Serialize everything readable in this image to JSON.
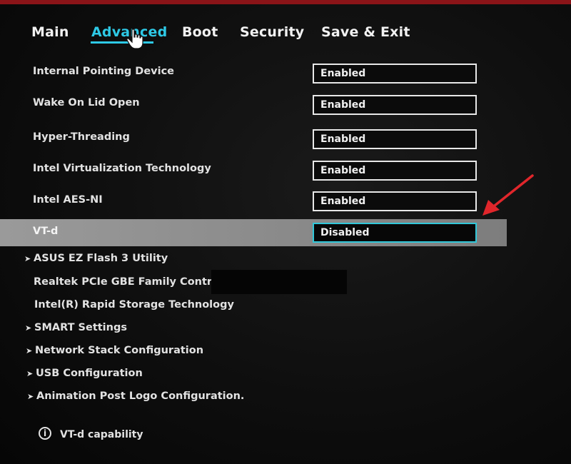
{
  "tabs": [
    "Main",
    "Advanced",
    "Boot",
    "Security",
    "Save & Exit"
  ],
  "settings": [
    {
      "label": "Internal Pointing Device",
      "value": "Enabled"
    },
    {
      "label": "Wake On Lid Open",
      "value": "Enabled"
    },
    {
      "label": "Hyper-Threading",
      "value": "Enabled"
    },
    {
      "label": "Intel Virtualization Technology",
      "value": "Enabled"
    },
    {
      "label": "Intel AES-NI",
      "value": "Enabled"
    },
    {
      "label": "VT-d",
      "value": "Disabled"
    }
  ],
  "menu": [
    {
      "label": "ASUS EZ Flash 3 Utility",
      "submenu": true
    },
    {
      "label": "Realtek PCIe GBE Family Controller",
      "submenu": false
    },
    {
      "label": "Intel(R) Rapid Storage Technology",
      "submenu": false
    },
    {
      "label": "SMART Settings",
      "submenu": true
    },
    {
      "label": "Network Stack Configuration",
      "submenu": true
    },
    {
      "label": "USB Configuration",
      "submenu": true
    },
    {
      "label": "Animation Post Logo Configuration.",
      "submenu": true
    }
  ],
  "help": {
    "icon": "info-icon",
    "text": "VT-d capability"
  },
  "colors": {
    "accent": "#2ec9e6",
    "highlight": "#8c8c8c",
    "arrow": "#e0262b"
  }
}
